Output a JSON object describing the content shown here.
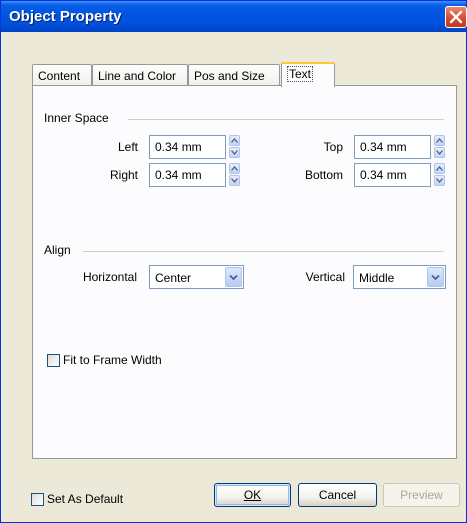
{
  "window": {
    "title": "Object Property"
  },
  "tabs": [
    {
      "label": "Content"
    },
    {
      "label": "Line and Color"
    },
    {
      "label": "Pos and Size"
    },
    {
      "label": "Text"
    }
  ],
  "inner_space": {
    "group_label": "Inner Space",
    "left_label": "Left",
    "left_value": "0.34 mm",
    "right_label": "Right",
    "right_value": "0.34 mm",
    "top_label": "Top",
    "top_value": "0.34 mm",
    "bottom_label": "Bottom",
    "bottom_value": "0.34 mm"
  },
  "align": {
    "group_label": "Align",
    "horizontal_label": "Horizontal",
    "horizontal_value": "Center",
    "vertical_label": "Vertical",
    "vertical_value": "Middle"
  },
  "fit_to_frame": {
    "label": "Fit to Frame Width",
    "checked": false
  },
  "footer": {
    "set_default_label": "Set As Default",
    "ok_label": "OK",
    "cancel_label": "Cancel",
    "preview_label": "Preview"
  },
  "colors": {
    "titlebar": "#0054e3",
    "dialog_bg": "#ece9d8",
    "active_tab_accent": "#ffc83c",
    "close_button": "#cf4a2e"
  }
}
